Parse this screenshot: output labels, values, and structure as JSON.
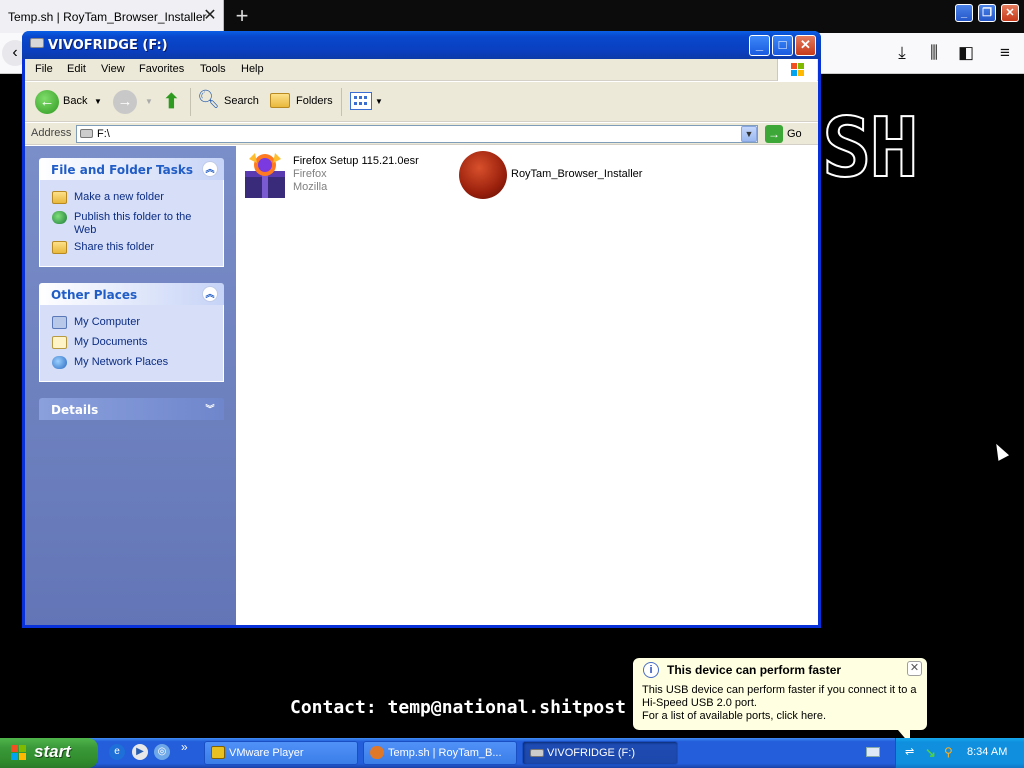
{
  "browser": {
    "tab_title": "Temp.sh | RoyTam_Browser_Installer",
    "tab_close": "✕",
    "new_tab": "+",
    "window_buttons": {
      "minimize": "_",
      "restore": "❐",
      "close": "✕"
    },
    "toolbar_icons": [
      "download-icon",
      "library-icon",
      "sidebar-icon",
      "menu-icon"
    ],
    "page_banner_text": "SH",
    "contact_line": "Contact: temp@national.shitpost"
  },
  "explorer": {
    "title": "VIVOFRIDGE (F:)",
    "caption_buttons": {
      "minimize": "_",
      "maximize": "□",
      "close": "✕"
    },
    "menu": [
      "File",
      "Edit",
      "View",
      "Favorites",
      "Tools",
      "Help"
    ],
    "toolbar": {
      "back": "Back",
      "search": "Search",
      "folders": "Folders"
    },
    "address": {
      "label": "Address",
      "value": "F:\\",
      "go": "Go"
    },
    "task_pane": {
      "file_folder_tasks": {
        "title": "File and Folder Tasks",
        "items": [
          "Make a new folder",
          "Publish this folder to the Web",
          "Share this folder"
        ]
      },
      "other_places": {
        "title": "Other Places",
        "items": [
          "My Computer",
          "My Documents",
          "My Network Places"
        ]
      },
      "details": {
        "title": "Details"
      }
    },
    "files": [
      {
        "name": "Firefox Setup 115.21.0esr",
        "line2": "Firefox",
        "line3": "Mozilla",
        "icon": "firefox-installer-icon"
      },
      {
        "name": "RoyTam_Browser_Installer",
        "icon": "red-sphere-icon"
      }
    ]
  },
  "balloon": {
    "title": "This device can perform faster",
    "lines": [
      "This USB device can perform faster if you connect it to a",
      "Hi-Speed USB 2.0 port.",
      "For a list of available ports, click here."
    ]
  },
  "taskbar": {
    "start": "start",
    "quick_launch_more": "»",
    "tasks": [
      {
        "label": "VMware Player",
        "active": false
      },
      {
        "label": "Temp.sh | RoyTam_B...",
        "active": false
      },
      {
        "label": "VIVOFRIDGE (F:)",
        "active": true
      }
    ],
    "clock": "8:34 AM"
  },
  "colors": {
    "xp_blue": "#245edb",
    "start_green": "#3c9a3a",
    "task_pane": "#6375b6",
    "balloon_bg": "#ffffe1"
  }
}
